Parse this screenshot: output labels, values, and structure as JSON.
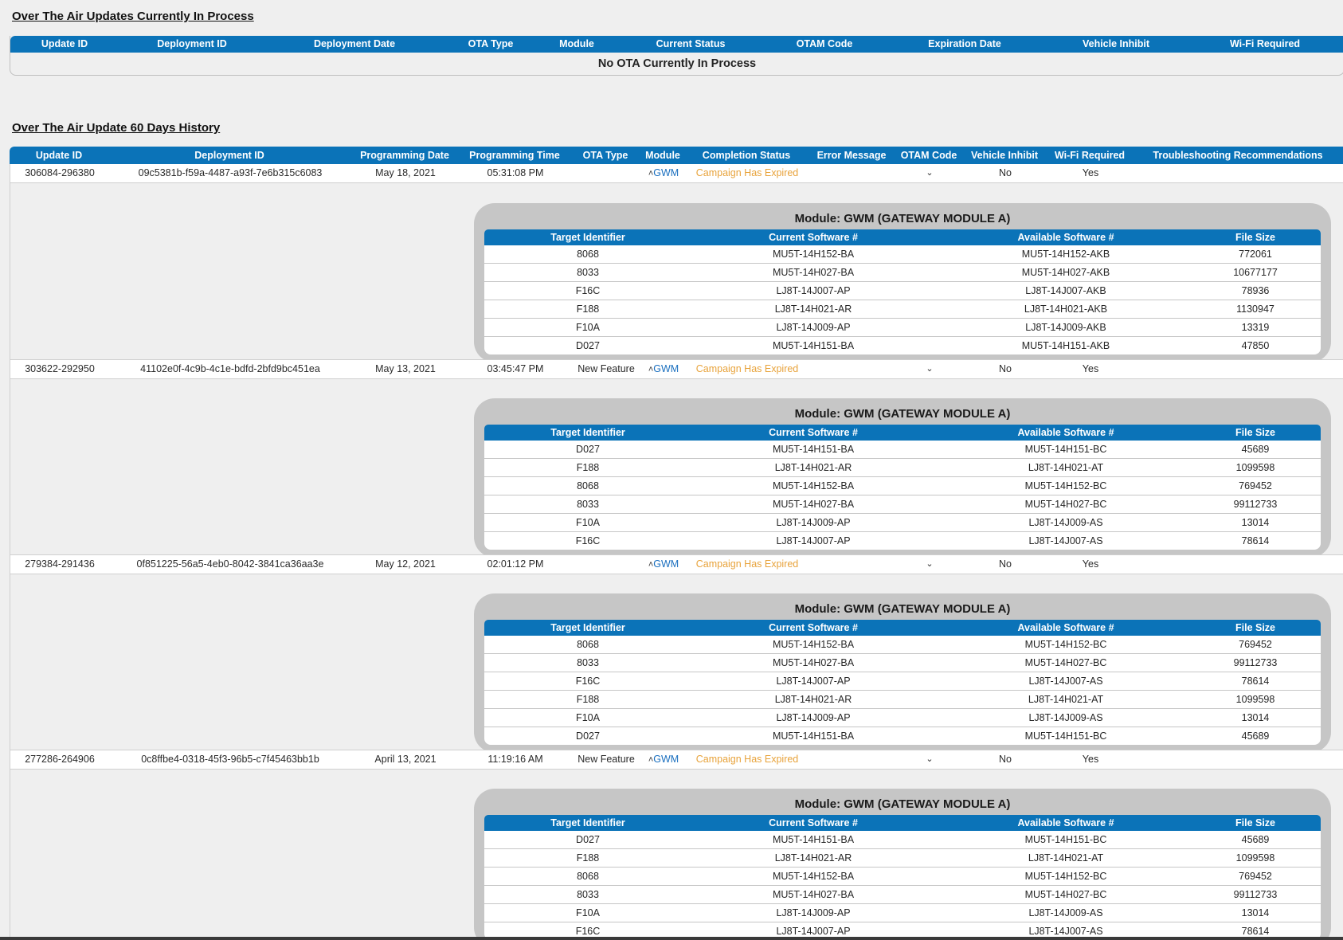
{
  "current": {
    "title": "Over The Air Updates Currently In Process",
    "columns": [
      "Update ID",
      "Deployment ID",
      "Deployment Date",
      "OTA Type",
      "Module",
      "Current Status",
      "OTAM Code",
      "Expiration Date",
      "Vehicle Inhibit",
      "Wi-Fi Required"
    ],
    "empty_message": "No OTA Currently In Process"
  },
  "history": {
    "title": "Over The Air Update 60 Days History",
    "columns": [
      "Update ID",
      "Deployment ID",
      "Programming Date",
      "Programming Time",
      "OTA Type",
      "Module",
      "Completion Status",
      "Error Message",
      "OTAM Code",
      "Vehicle Inhibit",
      "Wi-Fi Required",
      "Troubleshooting Recommendations"
    ],
    "detail_columns": [
      "Target Identifier",
      "Current Software #",
      "Available Software #",
      "File Size"
    ],
    "rows": [
      {
        "update_id": "306084-296380",
        "deployment_id": "09c5381b-f59a-4487-a93f-7e6b315c6083",
        "date": "May 18, 2021",
        "time": "05:31:08 PM",
        "ota_type": "",
        "module": "GWM",
        "status": "Campaign Has Expired",
        "inhibit": "No",
        "wifi": "Yes",
        "detail": {
          "title": "Module: GWM (GATEWAY MODULE A)",
          "rows": [
            [
              "8068",
              "MU5T-14H152-BA",
              "MU5T-14H152-AKB",
              "772061"
            ],
            [
              "8033",
              "MU5T-14H027-BA",
              "MU5T-14H027-AKB",
              "10677177"
            ],
            [
              "F16C",
              "LJ8T-14J007-AP",
              "LJ8T-14J007-AKB",
              "78936"
            ],
            [
              "F188",
              "LJ8T-14H021-AR",
              "LJ8T-14H021-AKB",
              "1130947"
            ],
            [
              "F10A",
              "LJ8T-14J009-AP",
              "LJ8T-14J009-AKB",
              "13319"
            ],
            [
              "D027",
              "MU5T-14H151-BA",
              "MU5T-14H151-AKB",
              "47850"
            ]
          ]
        }
      },
      {
        "update_id": "303622-292950",
        "deployment_id": "41102e0f-4c9b-4c1e-bdfd-2bfd9bc451ea",
        "date": "May 13, 2021",
        "time": "03:45:47 PM",
        "ota_type": "New Feature",
        "module": "GWM",
        "status": "Campaign Has Expired",
        "inhibit": "No",
        "wifi": "Yes",
        "detail": {
          "title": "Module: GWM (GATEWAY MODULE A)",
          "rows": [
            [
              "D027",
              "MU5T-14H151-BA",
              "MU5T-14H151-BC",
              "45689"
            ],
            [
              "F188",
              "LJ8T-14H021-AR",
              "LJ8T-14H021-AT",
              "1099598"
            ],
            [
              "8068",
              "MU5T-14H152-BA",
              "MU5T-14H152-BC",
              "769452"
            ],
            [
              "8033",
              "MU5T-14H027-BA",
              "MU5T-14H027-BC",
              "99112733"
            ],
            [
              "F10A",
              "LJ8T-14J009-AP",
              "LJ8T-14J009-AS",
              "13014"
            ],
            [
              "F16C",
              "LJ8T-14J007-AP",
              "LJ8T-14J007-AS",
              "78614"
            ]
          ]
        }
      },
      {
        "update_id": "279384-291436",
        "deployment_id": "0f851225-56a5-4eb0-8042-3841ca36aa3e",
        "date": "May 12, 2021",
        "time": "02:01:12 PM",
        "ota_type": "",
        "module": "GWM",
        "status": "Campaign Has Expired",
        "inhibit": "No",
        "wifi": "Yes",
        "detail": {
          "title": "Module: GWM (GATEWAY MODULE A)",
          "rows": [
            [
              "8068",
              "MU5T-14H152-BA",
              "MU5T-14H152-BC",
              "769452"
            ],
            [
              "8033",
              "MU5T-14H027-BA",
              "MU5T-14H027-BC",
              "99112733"
            ],
            [
              "F16C",
              "LJ8T-14J007-AP",
              "LJ8T-14J007-AS",
              "78614"
            ],
            [
              "F188",
              "LJ8T-14H021-AR",
              "LJ8T-14H021-AT",
              "1099598"
            ],
            [
              "F10A",
              "LJ8T-14J009-AP",
              "LJ8T-14J009-AS",
              "13014"
            ],
            [
              "D027",
              "MU5T-14H151-BA",
              "MU5T-14H151-BC",
              "45689"
            ]
          ]
        }
      },
      {
        "update_id": "277286-264906",
        "deployment_id": "0c8ffbe4-0318-45f3-96b5-c7f45463bb1b",
        "date": "April 13, 2021",
        "time": "11:19:16 AM",
        "ota_type": "New Feature",
        "module": "GWM",
        "status": "Campaign Has Expired",
        "inhibit": "No",
        "wifi": "Yes",
        "detail": {
          "title": "Module: GWM (GATEWAY MODULE A)",
          "rows": [
            [
              "D027",
              "MU5T-14H151-BA",
              "MU5T-14H151-BC",
              "45689"
            ],
            [
              "F188",
              "LJ8T-14H021-AR",
              "LJ8T-14H021-AT",
              "1099598"
            ],
            [
              "8068",
              "MU5T-14H152-BA",
              "MU5T-14H152-BC",
              "769452"
            ],
            [
              "8033",
              "MU5T-14H027-BA",
              "MU5T-14H027-BC",
              "99112733"
            ],
            [
              "F10A",
              "LJ8T-14J009-AP",
              "LJ8T-14J009-AS",
              "13014"
            ],
            [
              "F16C",
              "LJ8T-14J007-AP",
              "LJ8T-14J007-AS",
              "78614"
            ]
          ]
        }
      }
    ]
  },
  "icons": {
    "expand": "chevron-up-icon",
    "dropdown": "chevron-down-icon"
  },
  "colors": {
    "header": "#0b73b8",
    "link": "#1a6fbf",
    "status_expired": "#e8a33b",
    "panel": "#c6c6c6"
  }
}
